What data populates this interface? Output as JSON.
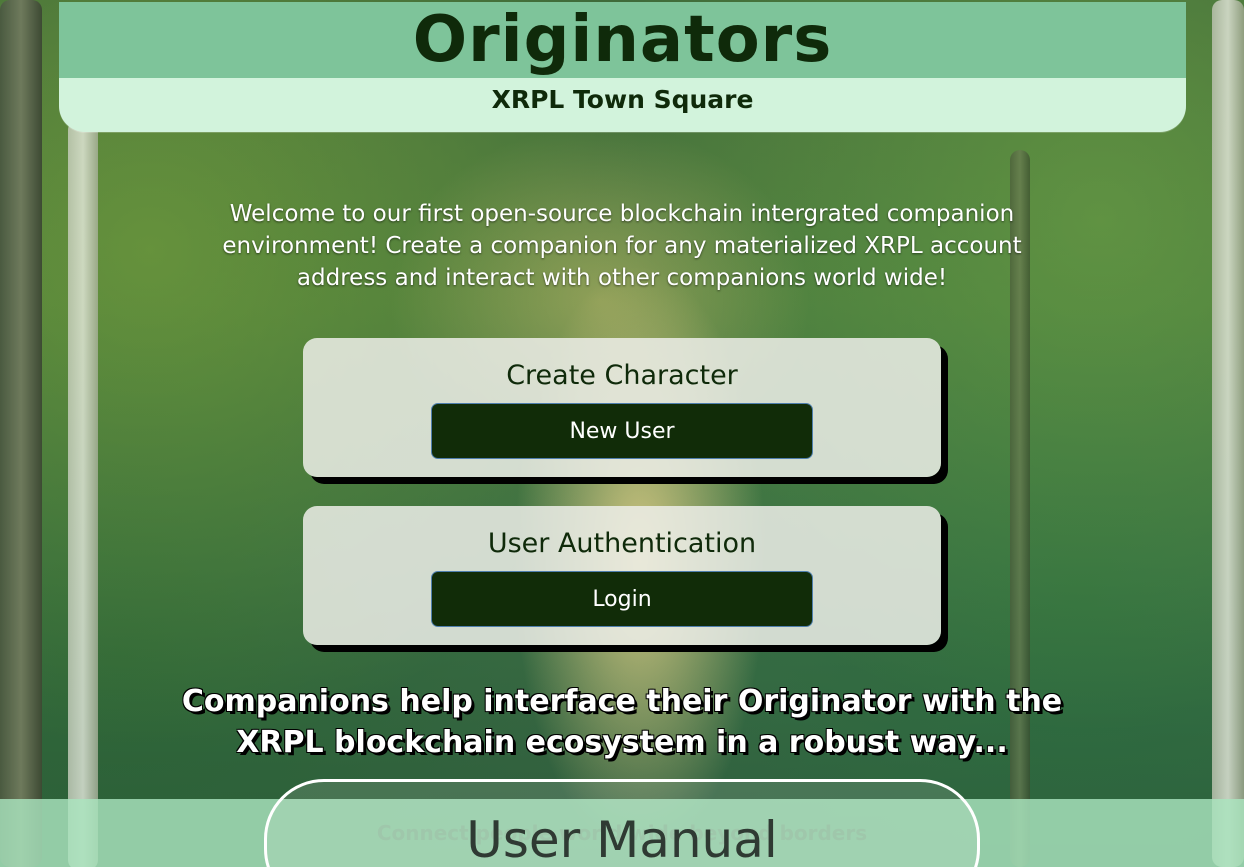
{
  "header": {
    "title": "Originators",
    "subtitle": "XRPL Town Square"
  },
  "intro": {
    "text": "Welcome to our first open-source blockchain intergrated companion environment! Create a companion for any materialized XRPL account address and interact with other companions world wide!"
  },
  "create_card": {
    "title": "Create Character",
    "button_label": "New User"
  },
  "auth_card": {
    "title": "User Authentication",
    "button_label": "Login"
  },
  "tagline": {
    "text": "Companions help interface their Originator with the XRPL blockchain ecosystem in a robust way..."
  },
  "footer": {
    "connect_text": "Connect people world wide beyond borders",
    "manual_label": "User Manual"
  },
  "colors": {
    "header_top": "#7ec49a",
    "header_bottom": "#d2f3dc",
    "title_text": "#0f2a0a",
    "button_bg": "#112c08",
    "button_border": "#4f7fae",
    "card_bg": "#ecede8",
    "footer_band": "#aae4be"
  }
}
